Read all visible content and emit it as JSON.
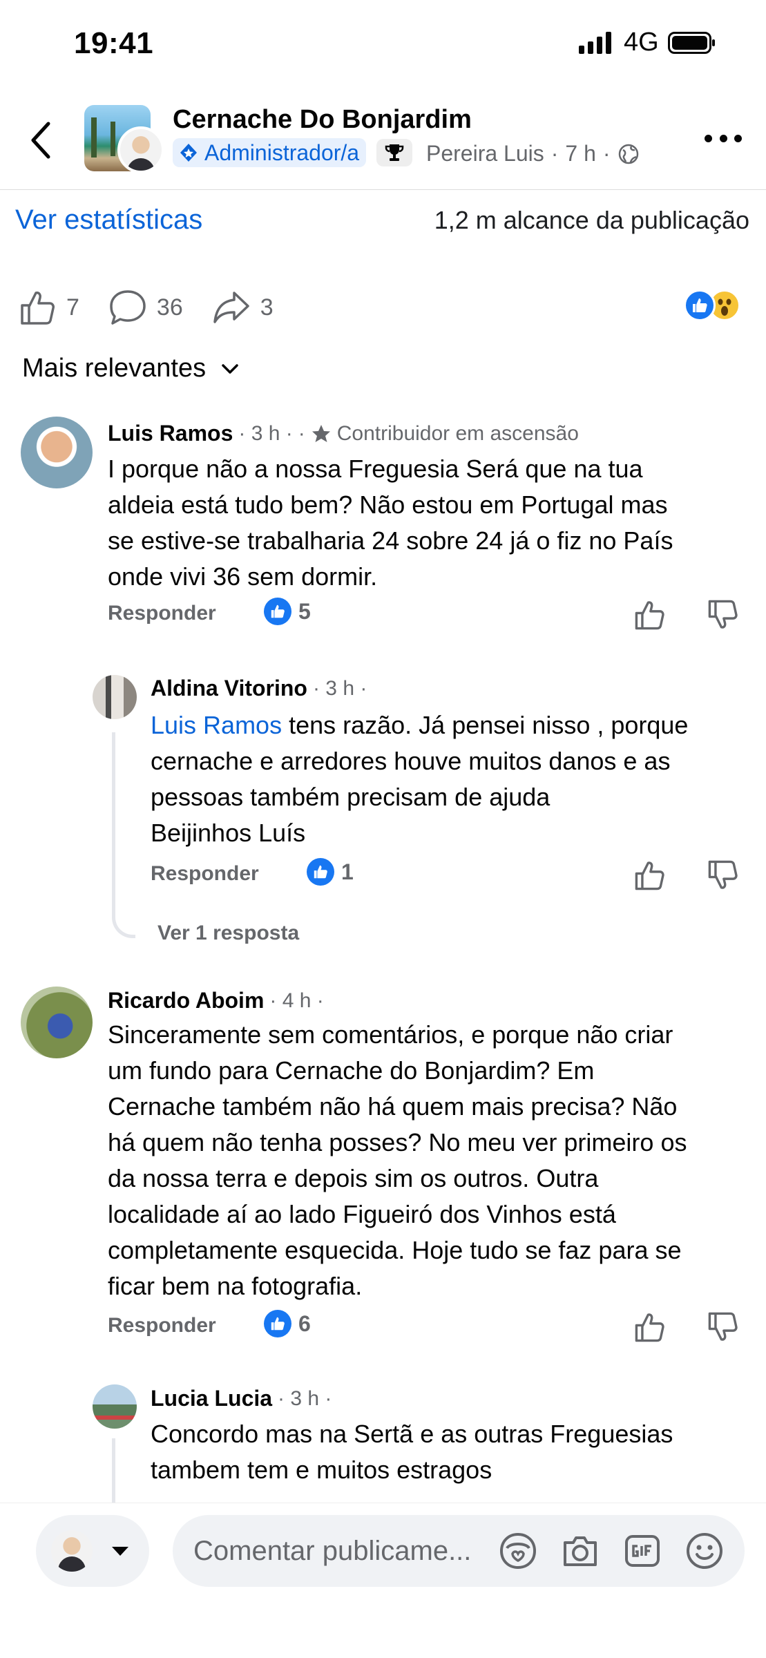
{
  "status": {
    "time": "19:41",
    "network": "4G"
  },
  "header": {
    "group_name": "Cernache Do Bonjardim",
    "role_badge": "Administrador/a",
    "author": "Pereira Luis",
    "age": "7 h"
  },
  "stats": {
    "link": "Ver estatísticas",
    "reach": "1,2 m alcance da publicação"
  },
  "actions": {
    "likes": "7",
    "comments": "36",
    "shares": "3"
  },
  "sort": {
    "label": "Mais relevantes"
  },
  "comments": [
    {
      "name": "Luis Ramos",
      "meta": "· 3 h ·",
      "badge": "Contribuidor em ascensão",
      "lines": [
        "I porque não a nossa Freguesia Será que na tua",
        "aldeia está tudo bem? Não estou em Portugal mas",
        "se estive-se trabalharia 24 sobre 24 já o fiz no País",
        "onde vivi 36 sem dormir."
      ],
      "reply_label": "Responder",
      "likes": "5"
    },
    {
      "name": "Aldina Vitorino",
      "meta": "· 3 h ·",
      "mention": "Luis Ramos",
      "line1_rest": " tens razão. Já pensei nisso , porque",
      "lines": [
        "cernache e arredores houve muitos danos e as",
        "pessoas também precisam de ajuda",
        "Beijinhos Luís"
      ],
      "reply_label": "Responder",
      "likes": "1",
      "view_replies": "Ver 1 resposta"
    },
    {
      "name": "Ricardo Aboim",
      "meta": "· 4 h ·",
      "lines": [
        "Sinceramente sem comentários, e porque não criar",
        "um fundo para Cernache do Bonjardim? Em",
        "Cernache também não há quem mais precisa? Não",
        "há quem não tenha posses? No meu ver primeiro os",
        "da nossa terra e depois sim os outros. Outra",
        "localidade aí ao lado Figueiró dos Vinhos está",
        "completamente esquecida. Hoje tudo se faz para se",
        "ficar bem na fotografia."
      ],
      "reply_label": "Responder",
      "likes": "6"
    },
    {
      "name": "Lucia Lucia",
      "meta": "· 3 h ·",
      "lines": [
        "Concordo mas na Sertã e as outras  Freguesias",
        "tambem tem e muitos estragos"
      ]
    }
  ],
  "composer": {
    "placeholder": "Comentar publicame..."
  },
  "colors": {
    "accent": "#0b64d8",
    "like": "#1877f2",
    "muted": "#65676b"
  }
}
